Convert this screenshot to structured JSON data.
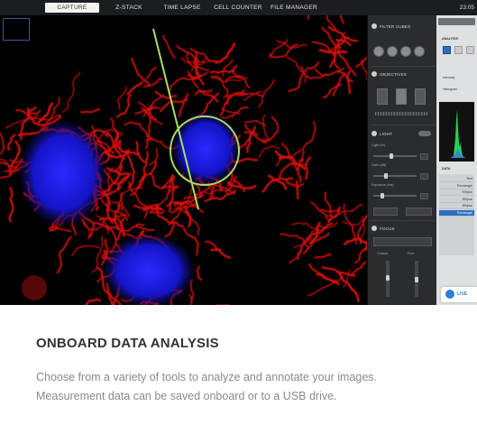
{
  "tabs": [
    {
      "label": "CAPTURE",
      "active": true
    },
    {
      "label": "Z-STACK",
      "active": false
    },
    {
      "label": "TIME LAPSE",
      "active": false
    },
    {
      "label": "CELL COUNTER",
      "active": false
    },
    {
      "label": "FILE MANAGER",
      "active": false
    }
  ],
  "clock": "23:05",
  "panel": {
    "filter_cubes": "FILTER CUBES",
    "objectives": "OBJECTIVES",
    "light": "LIGHT",
    "light_sub": "Light (%)",
    "gain": "Gain (dB)",
    "exposure": "Exposure (ms)",
    "focus": "FOCUS",
    "coarse": "Coarse",
    "fine": "Fine"
  },
  "analysis": {
    "title": "ANALYSIS",
    "intensity": "Intensity",
    "histogram": "Histogram",
    "data": "DATA",
    "rows": [
      "Text",
      "Rectangle",
      "Ellipse",
      "Ellipse",
      "Ellipse",
      "Rectangle"
    ],
    "selected_row": 5,
    "live": "LIVE"
  },
  "colors": {
    "nucleus": "#1414e0",
    "mitochondria": "#e01010",
    "annotation": "#a8e060",
    "accent": "#2c6fc2"
  },
  "caption": {
    "heading": "ONBOARD DATA ANALYSIS",
    "line1": "Choose from a variety of tools to analyze and annotate your images.",
    "line2": "Measurement data can be saved onboard or to a USB drive."
  }
}
